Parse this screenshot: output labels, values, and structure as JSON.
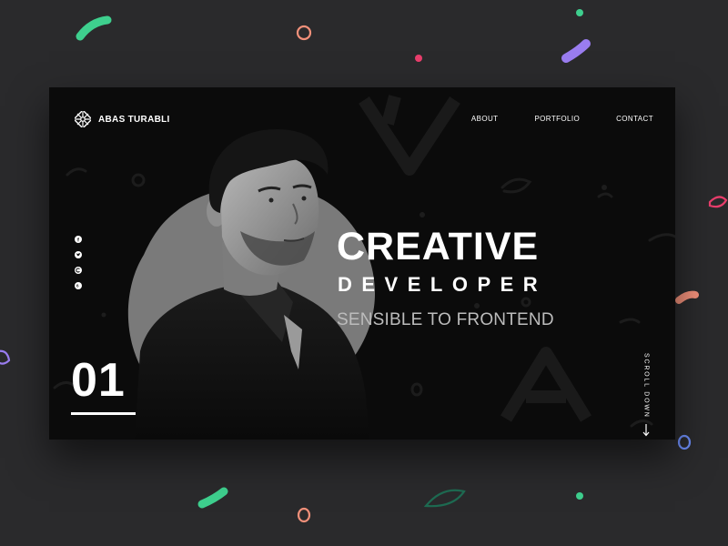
{
  "brand": {
    "name": "ABAS TURABLI",
    "logo_icon": "aztec-knot-icon"
  },
  "nav": [
    {
      "label": "ABOUT"
    },
    {
      "label": "PORTFOLIO"
    },
    {
      "label": "CONTACT"
    }
  ],
  "socials": [
    {
      "icon": "facebook-icon"
    },
    {
      "icon": "twitter-icon"
    },
    {
      "icon": "codepen-icon"
    },
    {
      "icon": "behance-icon"
    }
  ],
  "hero": {
    "line1": "CREATIVE",
    "line2": "DEVELOPER",
    "tagline": "SENSIBLE TO FRONTEND"
  },
  "slide": {
    "number": "01"
  },
  "scroll": {
    "label": "SCROLL DOWN",
    "icon": "arrow-down-icon"
  },
  "colors": {
    "outer_bg": "#2a2a2c",
    "site_bg": "#0b0b0b",
    "blob": "#7a7a7a",
    "confetti": [
      "#3ecf8e",
      "#f1907a",
      "#e83e6c",
      "#9a7df0",
      "#6c8cf5"
    ]
  }
}
